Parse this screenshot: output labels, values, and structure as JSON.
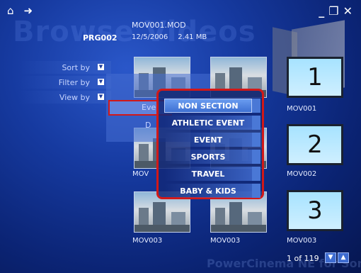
{
  "app": {
    "watermark": "Browse Videos",
    "footer_watermark": "PowerCinema NE for Sony"
  },
  "header": {
    "home_icon": "home-icon",
    "back_icon": "back-icon",
    "window_controls": [
      "minimize-icon",
      "restore-icon",
      "close-icon"
    ],
    "program": "PRG002",
    "file_name": "MOV001.MOD",
    "date": "12/5/2006",
    "size": "2.41 MB"
  },
  "sidebar": {
    "items": [
      {
        "label": "Sort by"
      },
      {
        "label": "Filter by"
      },
      {
        "label": "View by"
      }
    ]
  },
  "underlying_menu": {
    "row1": "Eve",
    "row2": "D"
  },
  "filter_menu": {
    "selected": "NON SECTION",
    "items": [
      "NON SECTION",
      "ATHLETIC EVENT",
      "EVENT",
      "SPORTS",
      "TRAVEL",
      "BABY & KIDS"
    ]
  },
  "thumbnails": {
    "labels": [
      "MOV001",
      "MOV002",
      "MOV003",
      "MOV003",
      "MOV003"
    ],
    "partial_label": "MOV",
    "numbers": [
      "1",
      "2",
      "3"
    ]
  },
  "pager": {
    "text": "1 of 119"
  },
  "colors": {
    "highlight": "#d21818",
    "background": "#163aa0"
  }
}
